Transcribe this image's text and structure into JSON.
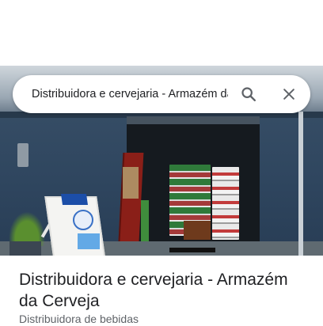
{
  "search": {
    "query": "Distribuidora e cervejaria - Armazém da Cerveja",
    "search_icon": "search-icon",
    "close_icon": "close-icon"
  },
  "photo": {
    "icon": "storefront-photo"
  },
  "place": {
    "title": "Distribuidora e cervejaria - Armazém da Cerveja",
    "category": "Distribuidora de bebidas"
  },
  "colors": {
    "text_primary": "#202124",
    "text_secondary": "#5f6368",
    "icon": "#5f6368"
  }
}
